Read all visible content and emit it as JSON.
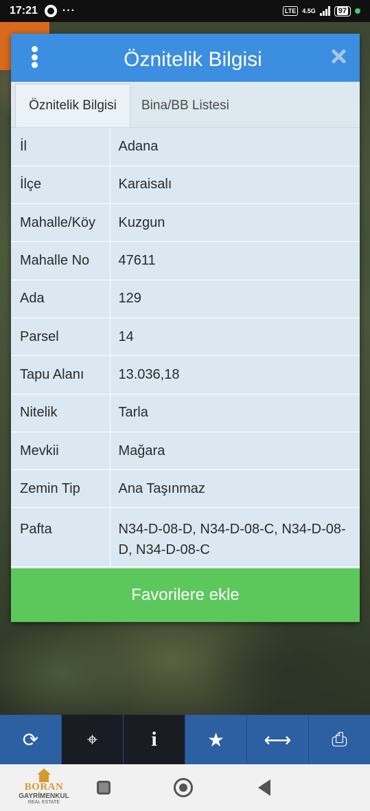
{
  "status_bar": {
    "time": "17:21",
    "dots": "···",
    "network": "4.5G",
    "battery": "97"
  },
  "dialog": {
    "title": "Öznitelik Bilgisi",
    "tabs": [
      {
        "label": "Öznitelik Bilgisi",
        "active": true
      },
      {
        "label": "Bina/BB Listesi",
        "active": false
      }
    ],
    "rows": [
      {
        "key": "İl",
        "value": "Adana"
      },
      {
        "key": "İlçe",
        "value": "Karaisalı"
      },
      {
        "key": "Mahalle/Köy",
        "value": "Kuzgun"
      },
      {
        "key": "Mahalle No",
        "value": "47611"
      },
      {
        "key": "Ada",
        "value": "129"
      },
      {
        "key": "Parsel",
        "value": "14"
      },
      {
        "key": "Tapu Alanı",
        "value": "13.036,18"
      },
      {
        "key": "Nitelik",
        "value": "Tarla"
      },
      {
        "key": "Mevkii",
        "value": "Mağara"
      },
      {
        "key": "Zemin Tip",
        "value": "Ana Taşınmaz"
      },
      {
        "key": "Pafta",
        "value": "N34-D-08-D, N34-D-08-C, N34-D-08-D, N34-D-08-C"
      }
    ],
    "favorite_button": "Favorilere ekle"
  },
  "toolbar": {
    "items": [
      {
        "icon": "refresh-icon",
        "glyph": "⟳"
      },
      {
        "icon": "crosshair-icon",
        "glyph": "⌖"
      },
      {
        "icon": "info-icon",
        "glyph": "i"
      },
      {
        "icon": "star-icon",
        "glyph": "★"
      },
      {
        "icon": "measure-arrows-icon",
        "glyph": "⟷"
      },
      {
        "icon": "print-icon",
        "glyph": "⎙"
      }
    ]
  },
  "logo": {
    "name": "BORAN",
    "subtitle": "GAYRİMENKUL",
    "tagline": "REAL ESTATE"
  },
  "colors": {
    "header": "#3b8ee0",
    "favorite": "#5cc85b",
    "toolbar": "#2d5fa3"
  }
}
